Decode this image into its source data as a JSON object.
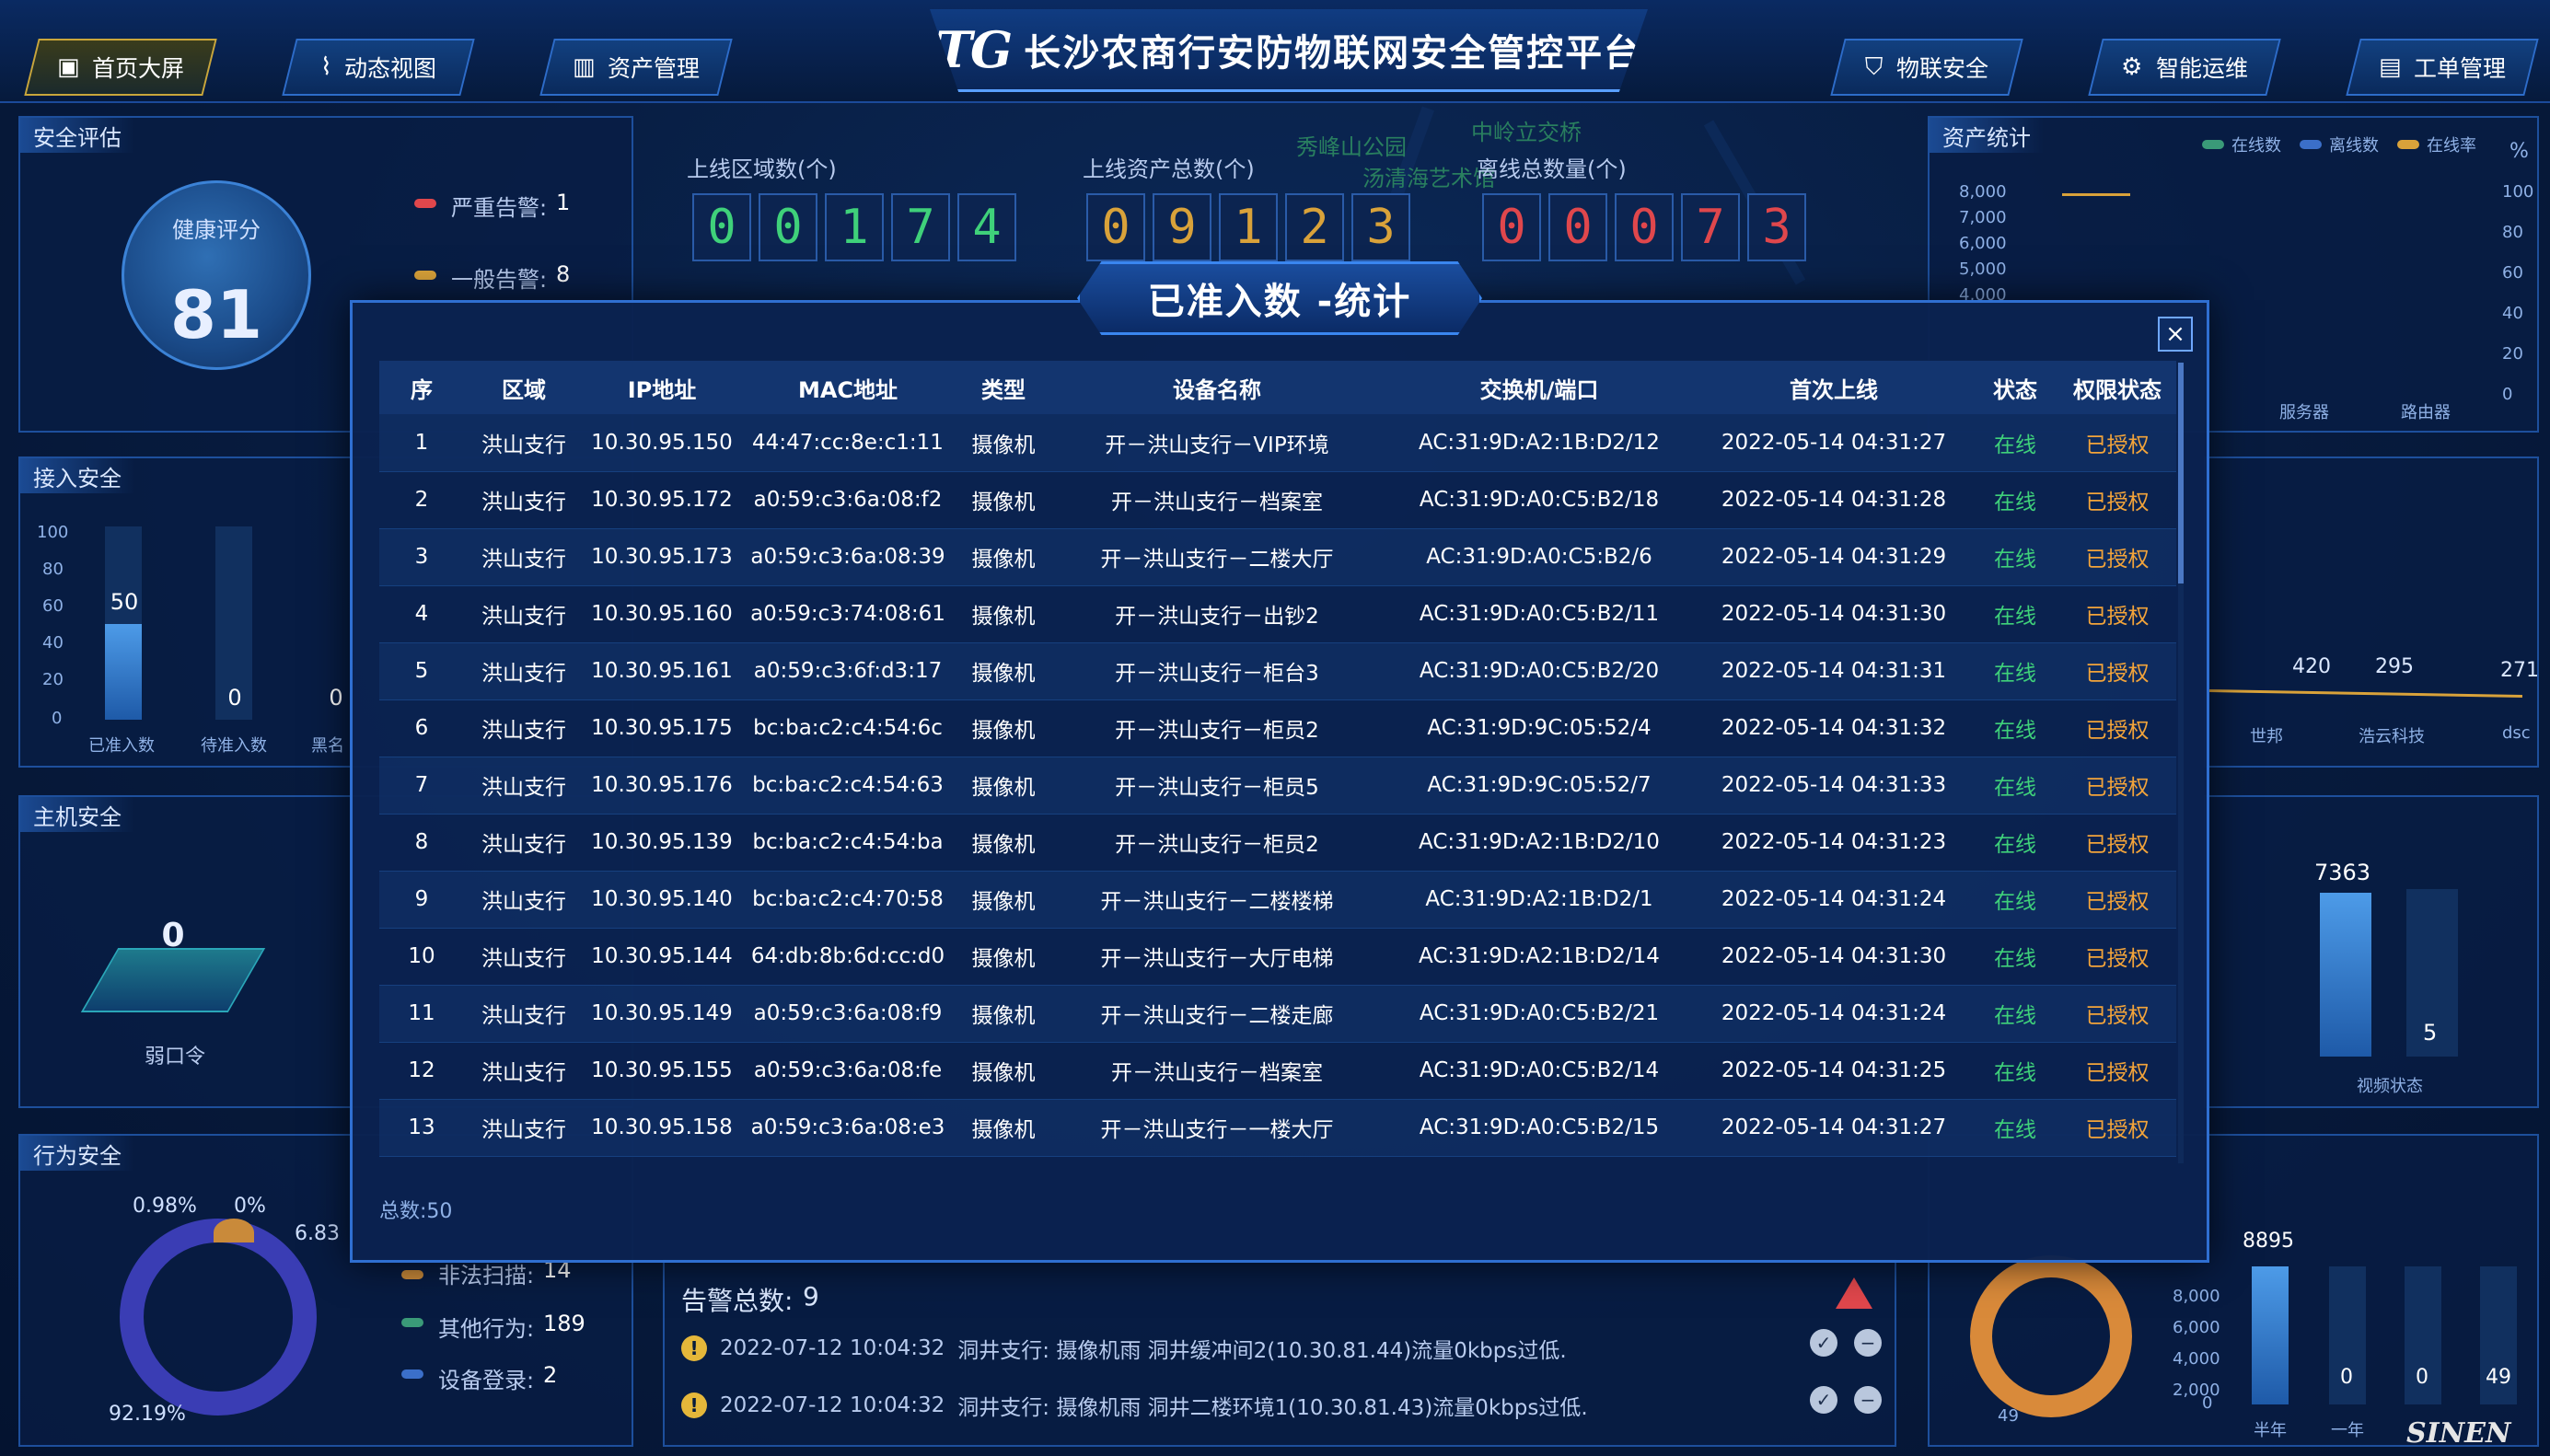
{
  "header": {
    "logo": "TG",
    "title": "长沙农商行安防物联网安全管控平台",
    "nav_left": [
      {
        "label": "首页大屏",
        "icon": "monitor-icon"
      },
      {
        "label": "动态视图",
        "icon": "chart-line-icon"
      },
      {
        "label": "资产管理",
        "icon": "bar-chart-icon"
      }
    ],
    "nav_right": [
      {
        "label": "物联安全",
        "icon": "shield-icon"
      },
      {
        "label": "智能运维",
        "icon": "gear-icon"
      },
      {
        "label": "工单管理",
        "icon": "document-icon"
      }
    ]
  },
  "map_labels": [
    "秀峰山公园",
    "中岭立交桥",
    "汤清海艺术馆"
  ],
  "safety_eval": {
    "title": "安全评估",
    "score_label": "健康评分",
    "score": "81",
    "alerts": [
      {
        "label": "严重告警:",
        "value": "1"
      },
      {
        "label": "一般告警:",
        "value": "8"
      }
    ]
  },
  "counters": [
    {
      "label": "上线区域数(个)",
      "digits": [
        "0",
        "0",
        "1",
        "7",
        "4"
      ]
    },
    {
      "label": "上线资产总数(个)",
      "digits": [
        "0",
        "9",
        "1",
        "2",
        "3"
      ]
    },
    {
      "label": "离线总数量(个)",
      "digits": [
        "0",
        "0",
        "0",
        "7",
        "3"
      ]
    }
  ],
  "asset_stats": {
    "title": "资产统计",
    "legend": [
      "在线数",
      "离线数",
      "在线率"
    ],
    "unit_right": "%",
    "y_left": [
      "8,000",
      "7,000",
      "6,000",
      "5,000",
      "4,000"
    ],
    "y_right": [
      "100",
      "80",
      "60",
      "40",
      "20",
      "0"
    ],
    "categories": [
      "服务器",
      "路由器"
    ]
  },
  "access_security": {
    "title": "接入安全",
    "y_ticks": [
      "100",
      "80",
      "60",
      "40",
      "20",
      "0"
    ],
    "bars": [
      {
        "label": "已准入数",
        "value": "50"
      },
      {
        "label": "待准入数",
        "value": "0"
      },
      {
        "label": "黑名",
        "value": "0"
      }
    ]
  },
  "vendor_line": {
    "points": [
      {
        "label": "世邦",
        "value": "420"
      },
      {
        "label": "浩云科技",
        "value": "295"
      },
      {
        "label": "dsc",
        "value": "271"
      }
    ]
  },
  "host_security": {
    "title": "主机安全",
    "value": "0",
    "label": "弱口令"
  },
  "video_status": {
    "label": "视频状态",
    "values": [
      "7363",
      "5"
    ]
  },
  "behavior_security": {
    "title": "行为安全",
    "percents": [
      "0.98%",
      "0%",
      "6.83",
      "92.19%"
    ],
    "items": [
      {
        "label": "非法扫描:",
        "value": "14"
      },
      {
        "label": "其他行为:",
        "value": "189"
      },
      {
        "label": "设备登录:",
        "value": "2"
      }
    ]
  },
  "alarm_panel": {
    "total_label": "告警总数:",
    "total": "9",
    "alerts": [
      {
        "time": "2022-07-12 10:04:32",
        "text": "洞井支行: 摄像机雨 洞井缓冲间2(10.30.81.44)流量0kbps过低."
      },
      {
        "time": "2022-07-12 10:04:32",
        "text": "洞井支行: 摄像机雨 洞井二楼环境1(10.30.81.43)流量0kbps过低."
      }
    ]
  },
  "donut_bottom_right": {
    "value": "49"
  },
  "bottom_bars": {
    "y_ticks": [
      "8,000",
      "6,000",
      "4,000",
      "2,000",
      "0"
    ],
    "categories": [
      "半年",
      "一年"
    ],
    "values": [
      "8895",
      "0",
      "0",
      "49"
    ]
  },
  "watermark": "SINEN",
  "modal": {
    "title": "已准入数 -统计",
    "columns": [
      "序",
      "区域",
      "IP地址",
      "MAC地址",
      "类型",
      "设备名称",
      "交换机/端口",
      "首次上线",
      "状态",
      "权限状态"
    ],
    "rows": [
      [
        "1",
        "洪山支行",
        "10.30.95.150",
        "44:47:cc:8e:c1:11",
        "摄像机",
        "开－洪山支行－VIP环境",
        "AC:31:9D:A2:1B:D2/12",
        "2022-05-14 04:31:27",
        "在线",
        "已授权"
      ],
      [
        "2",
        "洪山支行",
        "10.30.95.172",
        "a0:59:c3:6a:08:f2",
        "摄像机",
        "开－洪山支行－档案室",
        "AC:31:9D:A0:C5:B2/18",
        "2022-05-14 04:31:28",
        "在线",
        "已授权"
      ],
      [
        "3",
        "洪山支行",
        "10.30.95.173",
        "a0:59:c3:6a:08:39",
        "摄像机",
        "开－洪山支行－二楼大厅",
        "AC:31:9D:A0:C5:B2/6",
        "2022-05-14 04:31:29",
        "在线",
        "已授权"
      ],
      [
        "4",
        "洪山支行",
        "10.30.95.160",
        "a0:59:c3:74:08:61",
        "摄像机",
        "开－洪山支行－出钞2",
        "AC:31:9D:A0:C5:B2/11",
        "2022-05-14 04:31:30",
        "在线",
        "已授权"
      ],
      [
        "5",
        "洪山支行",
        "10.30.95.161",
        "a0:59:c3:6f:d3:17",
        "摄像机",
        "开－洪山支行－柜台3",
        "AC:31:9D:A0:C5:B2/20",
        "2022-05-14 04:31:31",
        "在线",
        "已授权"
      ],
      [
        "6",
        "洪山支行",
        "10.30.95.175",
        "bc:ba:c2:c4:54:6c",
        "摄像机",
        "开－洪山支行－柜员2",
        "AC:31:9D:9C:05:52/4",
        "2022-05-14 04:31:32",
        "在线",
        "已授权"
      ],
      [
        "7",
        "洪山支行",
        "10.30.95.176",
        "bc:ba:c2:c4:54:63",
        "摄像机",
        "开－洪山支行－柜员5",
        "AC:31:9D:9C:05:52/7",
        "2022-05-14 04:31:33",
        "在线",
        "已授权"
      ],
      [
        "8",
        "洪山支行",
        "10.30.95.139",
        "bc:ba:c2:c4:54:ba",
        "摄像机",
        "开－洪山支行－柜员2",
        "AC:31:9D:A2:1B:D2/10",
        "2022-05-14 04:31:23",
        "在线",
        "已授权"
      ],
      [
        "9",
        "洪山支行",
        "10.30.95.140",
        "bc:ba:c2:c4:70:58",
        "摄像机",
        "开－洪山支行－二楼楼梯",
        "AC:31:9D:A2:1B:D2/1",
        "2022-05-14 04:31:24",
        "在线",
        "已授权"
      ],
      [
        "10",
        "洪山支行",
        "10.30.95.144",
        "64:db:8b:6d:cc:d0",
        "摄像机",
        "开－洪山支行－大厅电梯",
        "AC:31:9D:A2:1B:D2/14",
        "2022-05-14 04:31:30",
        "在线",
        "已授权"
      ],
      [
        "11",
        "洪山支行",
        "10.30.95.149",
        "a0:59:c3:6a:08:f9",
        "摄像机",
        "开－洪山支行－二楼走廊",
        "AC:31:9D:A0:C5:B2/21",
        "2022-05-14 04:31:24",
        "在线",
        "已授权"
      ],
      [
        "12",
        "洪山支行",
        "10.30.95.155",
        "a0:59:c3:6a:08:fe",
        "摄像机",
        "开－洪山支行－档案室",
        "AC:31:9D:A0:C5:B2/14",
        "2022-05-14 04:31:25",
        "在线",
        "已授权"
      ],
      [
        "13",
        "洪山支行",
        "10.30.95.158",
        "a0:59:c3:6a:08:e3",
        "摄像机",
        "开－洪山支行－一楼大厅",
        "AC:31:9D:A0:C5:B2/15",
        "2022-05-14 04:31:27",
        "在线",
        "已授权"
      ]
    ],
    "total_label": "总数:50"
  },
  "colors": {
    "accent": "#2f6fd1",
    "online": "#3fd17a",
    "authorized": "#f3a43a",
    "severe": "#e0474c",
    "general": "#d9a23a",
    "green_digit": "#3fd17a",
    "yellow_digit": "#d9a23a",
    "red_digit": "#e0474c"
  }
}
